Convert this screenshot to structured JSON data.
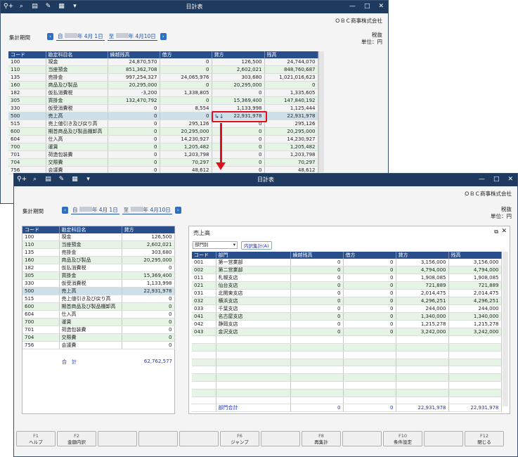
{
  "back": {
    "title": "日計表",
    "company": "ＯＢＣ商事株式会社",
    "period_label": "集計期間",
    "period_from": "自",
    "period_from_date": "年  4月 1日",
    "period_to": "至",
    "period_to_date": "年  4月10日",
    "tax": "税抜",
    "unit": "単位：円",
    "columns": [
      "コード",
      "勘定科目名",
      "繰越残高",
      "借方",
      "貸方",
      "残高"
    ],
    "rows": [
      [
        "100",
        "現金",
        "24,870,570",
        "0",
        "126,500",
        "24,744,070"
      ],
      [
        "110",
        "当座預金",
        "851,362,708",
        "0",
        "2,602,021",
        "848,760,687"
      ],
      [
        "135",
        "売掛金",
        "997,254,327",
        "24,065,976",
        "303,680",
        "1,021,016,623"
      ],
      [
        "160",
        "商品及び製品",
        "20,295,000",
        "0",
        "20,295,000",
        "0"
      ],
      [
        "182",
        "仮払消費税",
        "-3,200",
        "1,338,805",
        "0",
        "1,335,605"
      ],
      [
        "305",
        "買掛金",
        "132,470,792",
        "0",
        "15,369,400",
        "147,840,192"
      ],
      [
        "330",
        "仮受消費税",
        "0",
        "8,554",
        "1,133,998",
        "1,125,444"
      ],
      [
        "500",
        "売上高",
        "0",
        "0",
        "22,931,978",
        "22,931,978"
      ],
      [
        "515",
        "売上値引き及び戻り高",
        "0",
        "295,126",
        "0",
        "295,126"
      ],
      [
        "600",
        "期首商品及び製品棚卸高",
        "0",
        "20,295,000",
        "0",
        "20,295,000"
      ],
      [
        "604",
        "仕入高",
        "0",
        "14,230,927",
        "0",
        "14,230,927"
      ],
      [
        "700",
        "運賃",
        "0",
        "1,205,482",
        "0",
        "1,205,482"
      ],
      [
        "701",
        "荷造包装費",
        "0",
        "1,203,798",
        "0",
        "1,203,798"
      ],
      [
        "704",
        "交際費",
        "0",
        "70,297",
        "0",
        "70,297"
      ],
      [
        "756",
        "会議費",
        "0",
        "48,612",
        "0",
        "48,612"
      ]
    ]
  },
  "front": {
    "title": "日計表",
    "company": "ＯＢＣ商事株式会社",
    "period_label": "集計期間",
    "period_from": "自",
    "period_from_date": "年  4月 1日",
    "period_to": "至",
    "period_to_date": "年  4月10日",
    "tax": "税抜",
    "unit": "単位：円",
    "left_columns": [
      "コード",
      "勘定科目名",
      "貸方"
    ],
    "left_rows": [
      [
        "100",
        "現金",
        "126,500"
      ],
      [
        "110",
        "当座預金",
        "2,602,021"
      ],
      [
        "135",
        "売掛金",
        "303,680"
      ],
      [
        "160",
        "商品及び製品",
        "20,295,000"
      ],
      [
        "182",
        "仮払消費税",
        "0"
      ],
      [
        "305",
        "買掛金",
        "15,369,400"
      ],
      [
        "330",
        "仮受消費税",
        "1,133,998"
      ],
      [
        "500",
        "売上高",
        "22,931,978"
      ],
      [
        "515",
        "売上値引き及び戻り高",
        "0"
      ],
      [
        "600",
        "期首商品及び製品棚卸高",
        "0"
      ],
      [
        "604",
        "仕入高",
        "0"
      ],
      [
        "700",
        "運賃",
        "0"
      ],
      [
        "701",
        "荷造包装費",
        "0"
      ],
      [
        "704",
        "交際費",
        "0"
      ],
      [
        "756",
        "会議費",
        "0"
      ]
    ],
    "total_label": "合　計",
    "total_value": "62,762,577",
    "detail_title": "売上高",
    "dept_select": "部門別",
    "breakdown_button": "内訳集計(A)",
    "right_columns": [
      "コード",
      "部門",
      "繰越残高",
      "借方",
      "貸方",
      "残高"
    ],
    "right_rows": [
      [
        "001",
        "第一営業部",
        "0",
        "0",
        "3,156,000",
        "3,156,000"
      ],
      [
        "002",
        "第二営業部",
        "0",
        "0",
        "4,794,000",
        "4,794,000"
      ],
      [
        "011",
        "札幌支店",
        "0",
        "0",
        "1,908,085",
        "1,908,085"
      ],
      [
        "021",
        "仙台支店",
        "0",
        "0",
        "721,889",
        "721,889"
      ],
      [
        "031",
        "北関東支店",
        "0",
        "0",
        "2,014,475",
        "2,014,475"
      ],
      [
        "032",
        "横浜支店",
        "0",
        "0",
        "4,296,251",
        "4,296,251"
      ],
      [
        "033",
        "千葉支店",
        "0",
        "0",
        "244,000",
        "244,000"
      ],
      [
        "041",
        "名古屋支店",
        "0",
        "0",
        "1,340,000",
        "1,340,000"
      ],
      [
        "042",
        "静岡支店",
        "0",
        "0",
        "1,215,278",
        "1,215,278"
      ],
      [
        "043",
        "金沢支店",
        "0",
        "0",
        "3,242,000",
        "3,242,000"
      ]
    ],
    "right_total": [
      "部門合計",
      "0",
      "0",
      "22,931,978",
      "22,931,978"
    ],
    "fkeys": [
      {
        "key": "F1",
        "label": "ヘルプ"
      },
      {
        "key": "F2",
        "label": "金額内訳"
      },
      {
        "key": "",
        "label": ""
      },
      {
        "key": "",
        "label": ""
      },
      {
        "key": "",
        "label": ""
      },
      {
        "key": "F6",
        "label": "ジャンプ"
      },
      {
        "key": "",
        "label": ""
      },
      {
        "key": "F8",
        "label": "再集計"
      },
      {
        "key": "",
        "label": ""
      },
      {
        "key": "F10",
        "label": "条件設定"
      },
      {
        "key": "",
        "label": ""
      },
      {
        "key": "F12",
        "label": "閉じる"
      }
    ]
  },
  "colors": {
    "titlebar": "#1f3a5f",
    "header": "#284f8c",
    "alt_row": "#e6f4e6",
    "selected": "#cde0ea",
    "highlight": "#e01020"
  }
}
